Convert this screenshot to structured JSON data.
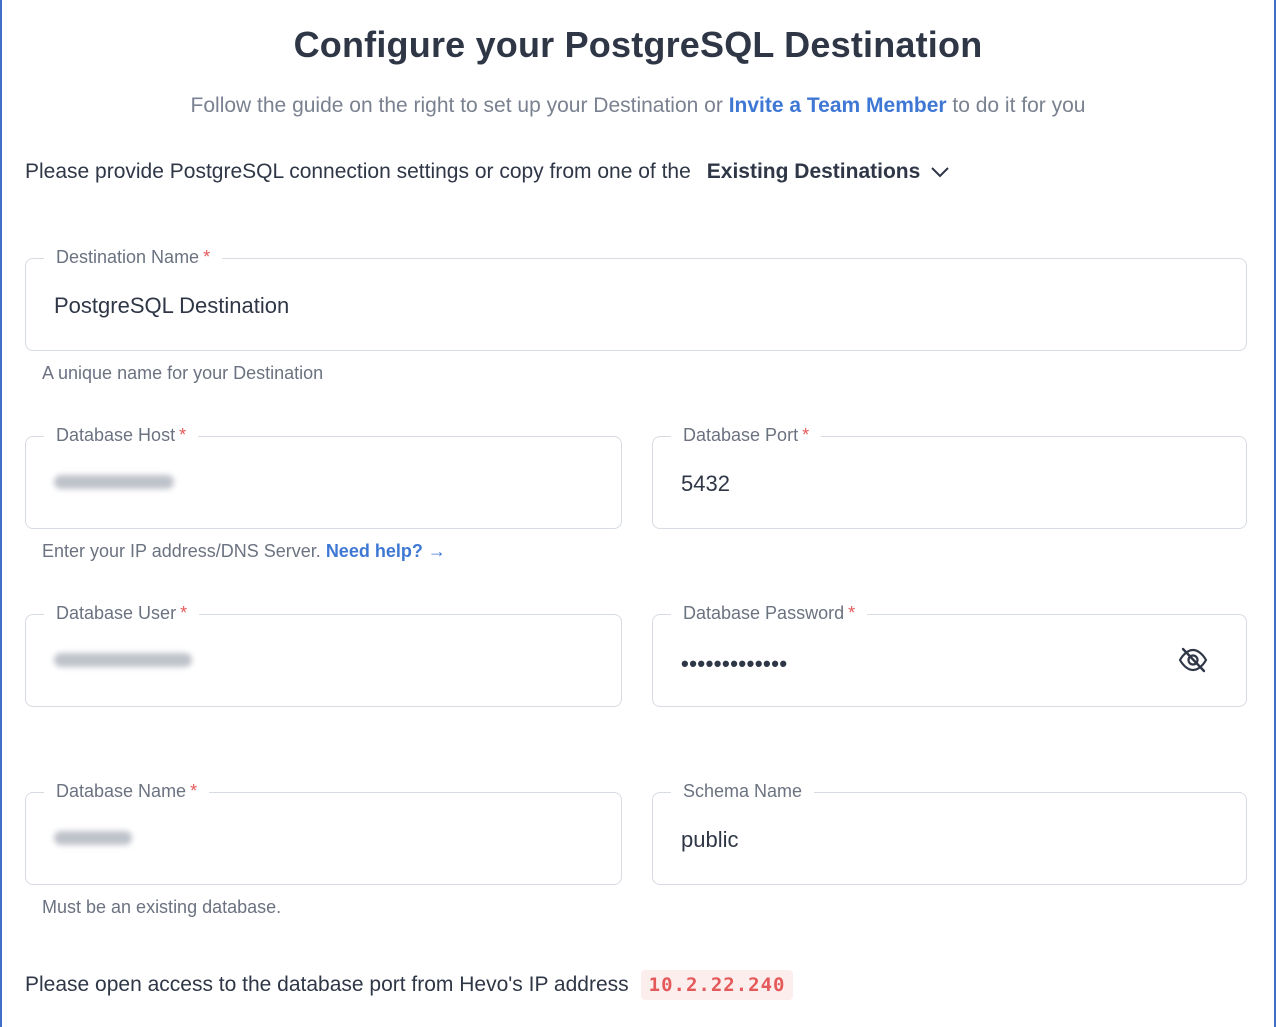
{
  "header": {
    "title": "Configure your PostgreSQL Destination",
    "subtitle_before": "Follow the guide on the right to set up your Destination or ",
    "subtitle_link": "Invite a Team Member",
    "subtitle_after": " to do it for you"
  },
  "provide": {
    "text": "Please provide PostgreSQL connection settings or copy from one of the",
    "existing_label": "Existing Destinations",
    "chevron_icon": "chevron-down-icon"
  },
  "fields": {
    "destination_name": {
      "label": "Destination Name",
      "required": "*",
      "value": "PostgreSQL Destination",
      "hint": "A unique name for your Destination"
    },
    "database_host": {
      "label": "Database Host",
      "required": "*",
      "hint": "Enter your IP address/DNS Server.",
      "help_link": "Need help? →"
    },
    "database_port": {
      "label": "Database Port",
      "required": "*",
      "value": "5432"
    },
    "database_user": {
      "label": "Database User",
      "required": "*"
    },
    "database_password": {
      "label": "Database Password",
      "required": "*",
      "value": "•••••••••••••",
      "toggle_icon": "eye-slash-icon"
    },
    "database_name": {
      "label": "Database Name",
      "required": "*",
      "hint": "Must be an existing database."
    },
    "schema_name": {
      "label": "Schema Name",
      "value": "public"
    }
  },
  "footer": {
    "text": "Please open access to the database port from Hevo's IP address",
    "ip": "10.2.22.240"
  },
  "colors": {
    "accent": "#3f78d4",
    "required": "#e45a5a",
    "border": "#d7dbe2",
    "text": "#2f3747",
    "muted": "#6b7280"
  }
}
